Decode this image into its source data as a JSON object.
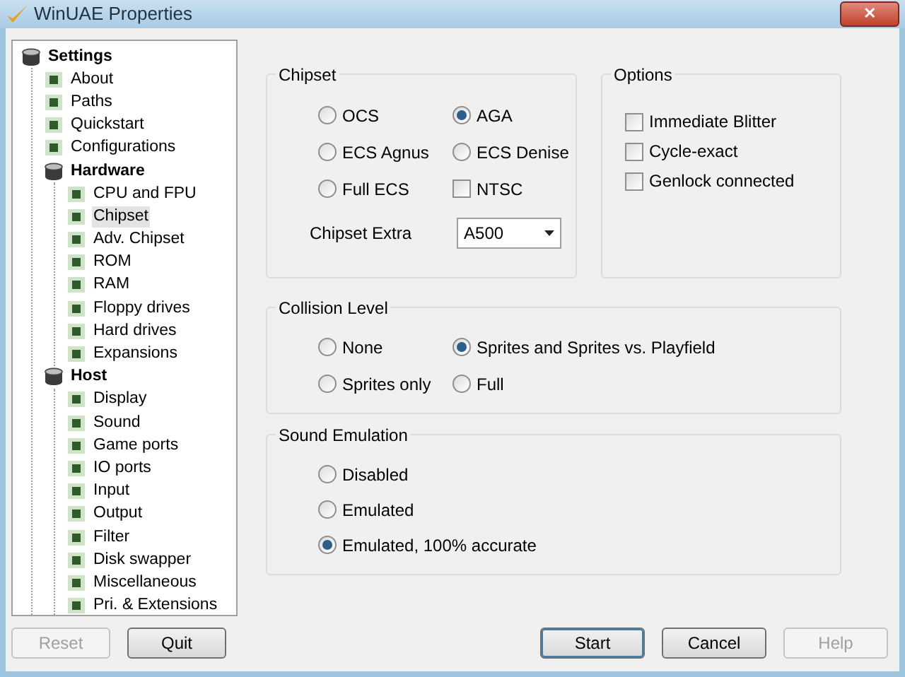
{
  "window": {
    "title": "WinUAE Properties",
    "close": "✕"
  },
  "tree": [
    {
      "label": "Settings",
      "selected": false,
      "children": [
        {
          "label": "About",
          "selected": false
        },
        {
          "label": "Paths",
          "selected": false
        },
        {
          "label": "Quickstart",
          "selected": false
        },
        {
          "label": "Configurations",
          "selected": false
        },
        {
          "label": "Hardware",
          "selected": false,
          "children": [
            {
              "label": "CPU and FPU",
              "selected": false
            },
            {
              "label": "Chipset",
              "selected": true
            },
            {
              "label": "Adv. Chipset",
              "selected": false
            },
            {
              "label": "ROM",
              "selected": false
            },
            {
              "label": "RAM",
              "selected": false
            },
            {
              "label": "Floppy drives",
              "selected": false
            },
            {
              "label": "Hard drives",
              "selected": false
            },
            {
              "label": "Expansions",
              "selected": false
            }
          ]
        },
        {
          "label": "Host",
          "selected": false,
          "children": [
            {
              "label": "Display",
              "selected": false
            },
            {
              "label": "Sound",
              "selected": false
            },
            {
              "label": "Game ports",
              "selected": false
            },
            {
              "label": "IO ports",
              "selected": false
            },
            {
              "label": "Input",
              "selected": false
            },
            {
              "label": "Output",
              "selected": false
            },
            {
              "label": "Filter",
              "selected": false
            },
            {
              "label": "Disk swapper",
              "selected": false
            },
            {
              "label": "Miscellaneous",
              "selected": false
            },
            {
              "label": "Pri. & Extensions",
              "selected": false
            }
          ]
        }
      ]
    }
  ],
  "chipset": {
    "title": "Chipset",
    "options": [
      {
        "kind": "radio",
        "label": "OCS",
        "selected": false
      },
      {
        "kind": "radio",
        "label": "AGA",
        "selected": true
      },
      {
        "kind": "radio",
        "label": "ECS Agnus",
        "selected": false
      },
      {
        "kind": "radio",
        "label": "ECS Denise",
        "selected": false
      },
      {
        "kind": "radio",
        "label": "Full ECS",
        "selected": false
      },
      {
        "kind": "checkbox",
        "label": "NTSC",
        "checked": false
      }
    ],
    "extra_label": "Chipset Extra",
    "extra_value": "A500"
  },
  "options": {
    "title": "Options",
    "items": [
      {
        "label": "Immediate Blitter",
        "checked": false
      },
      {
        "label": "Cycle-exact",
        "checked": false
      },
      {
        "label": "Genlock connected",
        "checked": false
      }
    ]
  },
  "collision": {
    "title": "Collision Level",
    "options": [
      {
        "label": "None",
        "selected": false
      },
      {
        "label": "Sprites and Sprites vs. Playfield",
        "selected": true
      },
      {
        "label": "Sprites only",
        "selected": false
      },
      {
        "label": "Full",
        "selected": false
      }
    ]
  },
  "sound": {
    "title": "Sound Emulation",
    "options": [
      {
        "label": "Disabled",
        "selected": false
      },
      {
        "label": "Emulated",
        "selected": false
      },
      {
        "label": "Emulated, 100% accurate",
        "selected": true
      }
    ]
  },
  "left_buttons": [
    {
      "label": "Reset",
      "disabled": true
    },
    {
      "label": "Quit",
      "disabled": false
    }
  ],
  "right_buttons": [
    {
      "label": "Start",
      "disabled": false,
      "default": true
    },
    {
      "label": "Cancel",
      "disabled": false,
      "default": false
    },
    {
      "label": "Help",
      "disabled": true,
      "default": false
    }
  ]
}
